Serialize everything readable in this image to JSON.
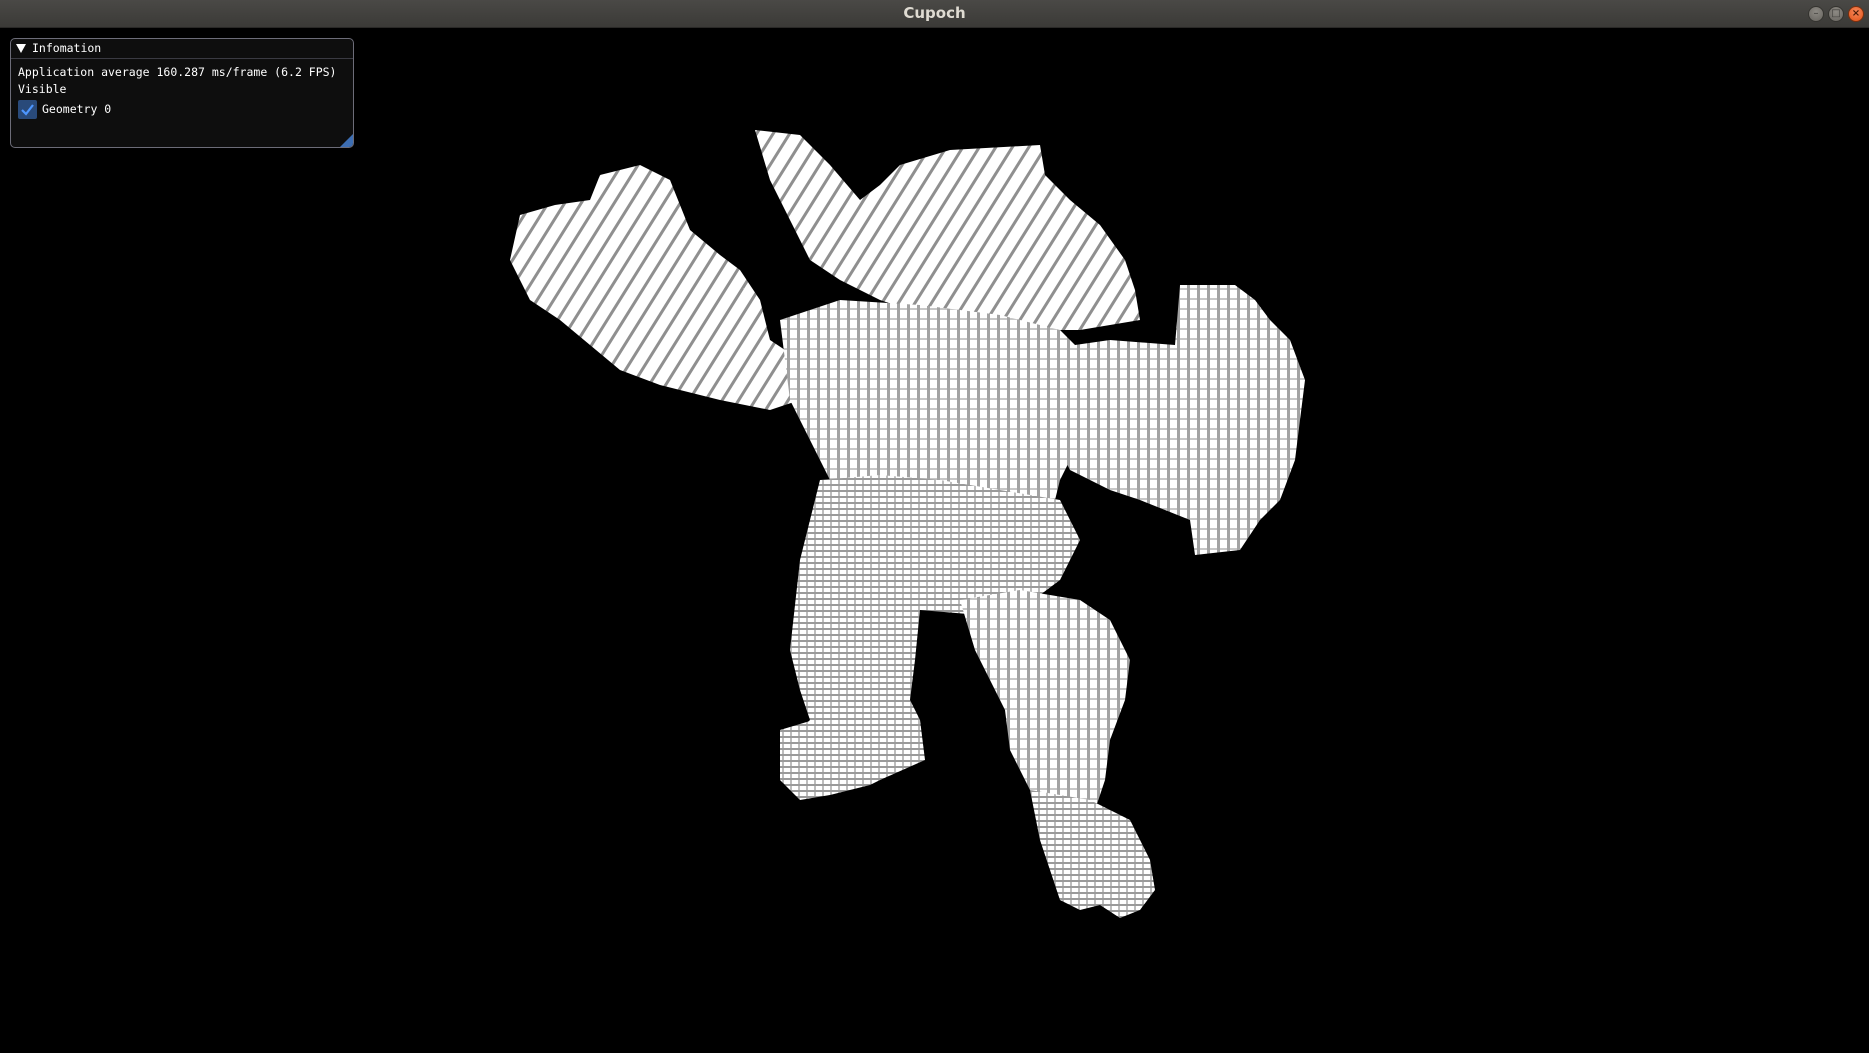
{
  "window": {
    "title": "Cupoch",
    "controls": {
      "minimize_icon": "minimize-icon",
      "maximize_icon": "maximize-icon",
      "close_icon": "close-icon"
    }
  },
  "panel": {
    "header": "Infomation",
    "fps_text": "Application average 160.287 ms/frame (6.2 FPS)",
    "visible_label": "Visible",
    "geometries": [
      {
        "label": "Geometry 0",
        "checked": true
      }
    ]
  },
  "scene": {
    "background": "#000000",
    "voxel_color": "#ffffff",
    "shade_color": "#8f8f8f"
  },
  "colors": {
    "panel_bg": "#0f0f0f",
    "panel_border": "#6c6c78",
    "checkbox_bg": "#294a7a",
    "check_mark": "#4d96ff",
    "titlebar": "#3f3e3b"
  }
}
